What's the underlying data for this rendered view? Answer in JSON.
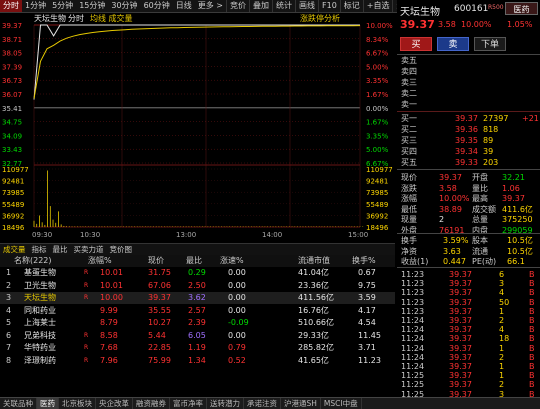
{
  "topbar": {
    "timeframes": [
      "分时",
      "1分钟",
      "5分钟",
      "15分钟",
      "30分钟",
      "60分钟",
      "日线",
      "更多 >"
    ],
    "tools": [
      "竞价",
      "叠加",
      "统计",
      "画线",
      "F10",
      "标记",
      "+自选",
      "返回"
    ]
  },
  "chart": {
    "header_name": "天坛生物",
    "header_mode": "分时",
    "header_legend": "均线 成交量",
    "limit_monitor": "涨跌停分析",
    "price_labels": [
      "39.37",
      "38.71",
      "38.05",
      "37.39",
      "36.73",
      "36.07",
      "35.41",
      "34.75",
      "34.09",
      "33.43",
      "32.77"
    ],
    "pct_labels": [
      "10.00%",
      "8.34%",
      "6.67%",
      "5.00%",
      "3.35%",
      "1.67%",
      "0.00%",
      "1.67%",
      "3.35%",
      "5.00%",
      "6.67%"
    ],
    "volume_labels": [
      "110977",
      "92481",
      "73985",
      "55489",
      "36992",
      "18496"
    ],
    "time_labels": [
      "09:30",
      "10:30",
      "13:00",
      "14:00",
      "15:00"
    ],
    "price_series": [
      35.8,
      39.37,
      39.37,
      38.85,
      39.37,
      39.37,
      39.37,
      39.37,
      39.37,
      39.37,
      39.37,
      39.37,
      39.37,
      39.37,
      39.37,
      39.37,
      39.37,
      39.37,
      39.37,
      39.37,
      39.37,
      39.37,
      39.37,
      39.37,
      39.37,
      39.37,
      39.37,
      39.37,
      39.37,
      39.37,
      39.37,
      39.37,
      39.37,
      39.37,
      39.37,
      39.37,
      39.37,
      39.37,
      39.37,
      39.37,
      39.37,
      39.37,
      39.37,
      39.37,
      39.37,
      39.37,
      39.37,
      39.37,
      39.37,
      39.37,
      39.37
    ],
    "volume_series": [
      12000,
      6000,
      22000,
      9000,
      4000,
      108000,
      40000,
      14000,
      8000,
      30000,
      5000,
      2000,
      1500,
      1200,
      1000,
      900,
      800,
      800,
      700,
      600,
      500,
      500,
      400,
      400,
      400,
      300,
      300,
      300,
      300,
      300,
      300,
      200,
      200,
      200,
      200,
      200,
      200,
      200,
      200,
      200,
      200,
      200,
      200,
      200,
      200,
      200,
      200,
      200,
      200,
      200,
      200,
      200,
      200,
      200,
      200,
      200,
      200,
      200,
      200,
      200,
      200,
      200,
      200,
      200,
      200,
      200,
      200,
      200,
      200,
      200,
      200,
      200,
      200,
      200,
      200,
      200,
      200,
      200,
      200,
      200,
      200,
      200,
      200,
      200,
      200,
      200,
      200,
      200,
      200,
      200,
      200,
      200,
      200,
      200,
      200,
      200,
      200,
      200,
      200,
      200,
      200,
      200,
      200,
      200,
      200,
      200,
      200,
      200,
      200,
      200,
      200,
      200,
      200,
      200,
      200,
      200,
      200,
      200,
      200,
      200,
      200,
      200
    ]
  },
  "stock": {
    "name": "天坛生物",
    "code": "600161",
    "tag": "R500",
    "sector_button": "医药",
    "sector_pct": "1.05%",
    "price": "39.37",
    "change": "3.58",
    "change_pct": "10.00%",
    "buy_label": "买",
    "sell_label": "卖",
    "order_label": "下单"
  },
  "depth": {
    "asks": [
      {
        "label": "卖五",
        "price": "",
        "vol": ""
      },
      {
        "label": "卖四",
        "price": "",
        "vol": ""
      },
      {
        "label": "卖三",
        "price": "",
        "vol": ""
      },
      {
        "label": "卖二",
        "price": "",
        "vol": ""
      },
      {
        "label": "卖一",
        "price": "",
        "vol": ""
      }
    ],
    "bids": [
      {
        "label": "买一",
        "price": "39.37",
        "vol": "27397",
        "extra": "+21"
      },
      {
        "label": "买二",
        "price": "39.36",
        "vol": "818",
        "extra": ""
      },
      {
        "label": "买三",
        "price": "39.35",
        "vol": "89",
        "extra": ""
      },
      {
        "label": "买四",
        "price": "39.34",
        "vol": "39",
        "extra": ""
      },
      {
        "label": "买五",
        "price": "39.33",
        "vol": "203",
        "extra": ""
      }
    ]
  },
  "quote": [
    {
      "l1": "现价",
      "v1": "39.37",
      "c1": "red",
      "l2": "开盘",
      "v2": "32.21",
      "c2": "grn"
    },
    {
      "l1": "涨跌",
      "v1": "3.58",
      "c1": "red",
      "l2": "量比",
      "v2": "1.06",
      "c2": "red"
    },
    {
      "l1": "涨幅",
      "v1": "10.00%",
      "c1": "red",
      "l2": "最高",
      "v2": "39.37",
      "c2": "red"
    },
    {
      "l1": "最低",
      "v1": "38.89",
      "c1": "red",
      "l2": "成交额",
      "v2": "411.6亿",
      "c2": "yel"
    },
    {
      "l1": "现量",
      "v1": "2",
      "c1": "wht",
      "l2": "总量",
      "v2": "375250",
      "c2": "yel"
    },
    {
      "l1": "外盘",
      "v1": "76191",
      "c1": "red",
      "l2": "内盘",
      "v2": "299059",
      "c2": "grn"
    }
  ],
  "quote2": [
    {
      "l1": "换手",
      "v1": "3.59%",
      "l2": "股本",
      "v2": "10.5亿"
    },
    {
      "l1": "净资",
      "v1": "3.63",
      "l2": "流通",
      "v2": "10.5亿"
    },
    {
      "l1": "收益(1)",
      "v1": "0.447",
      "l2": "PE(动)",
      "v2": "66.1"
    }
  ],
  "ticks": [
    {
      "time": "11:23",
      "price": "39.37",
      "vol": "6",
      "flag": "B"
    },
    {
      "time": "11:23",
      "price": "39.37",
      "vol": "3",
      "flag": "B"
    },
    {
      "time": "11:23",
      "price": "39.37",
      "vol": "4",
      "flag": "B"
    },
    {
      "time": "11:23",
      "price": "39.37",
      "vol": "50",
      "flag": "B"
    },
    {
      "time": "11:23",
      "price": "39.37",
      "vol": "1",
      "flag": "B"
    },
    {
      "time": "11:24",
      "price": "39.37",
      "vol": "2",
      "flag": "B"
    },
    {
      "time": "11:24",
      "price": "39.37",
      "vol": "4",
      "flag": "B"
    },
    {
      "time": "11:24",
      "price": "39.37",
      "vol": "18",
      "flag": "B"
    },
    {
      "time": "11:24",
      "price": "39.37",
      "vol": "1",
      "flag": "B"
    },
    {
      "time": "11:24",
      "price": "39.37",
      "vol": "2",
      "flag": "B"
    },
    {
      "time": "11:24",
      "price": "39.37",
      "vol": "1",
      "flag": "B"
    },
    {
      "time": "11:25",
      "price": "39.37",
      "vol": "1",
      "flag": "B"
    },
    {
      "time": "11:25",
      "price": "39.37",
      "vol": "2",
      "flag": "B"
    },
    {
      "time": "11:25",
      "price": "39.37",
      "vol": "3",
      "flag": "B"
    }
  ],
  "bottom_tabs": [
    "成交量",
    "指标",
    "最比",
    "买卖力道",
    "竞价图"
  ],
  "table": {
    "headers": [
      "名称(222)",
      "涨幅%",
      "现价",
      "最比",
      "涨速%",
      "流通市值",
      "换手%"
    ],
    "rows": [
      {
        "n": "1",
        "name": "基蛋生物",
        "r": "R",
        "pct": "10.01",
        "price": "31.75",
        "q": "0.29",
        "qc": "grn",
        "spd": "0.00",
        "cap": "41.04亿",
        "turn": "0.67"
      },
      {
        "n": "2",
        "name": "卫光生物",
        "r": "R",
        "pct": "10.01",
        "price": "67.06",
        "q": "2.50",
        "qc": "red",
        "spd": "0.00",
        "cap": "23.36亿",
        "turn": "9.75"
      },
      {
        "n": "3",
        "name": "天坛生物",
        "r": "R",
        "pct": "10.00",
        "price": "39.37",
        "q": "3.62",
        "qc": "pur",
        "spd": "0.00",
        "cap": "411.56亿",
        "turn": "3.59"
      },
      {
        "n": "4",
        "name": "同和药业",
        "r": "",
        "pct": "9.99",
        "price": "35.55",
        "q": "2.57",
        "qc": "red",
        "spd": "0.00",
        "cap": "16.76亿",
        "turn": "4.17"
      },
      {
        "n": "5",
        "name": "上海莱士",
        "r": "",
        "pct": "8.79",
        "price": "10.27",
        "q": "2.39",
        "qc": "red",
        "spd": "-0.09",
        "cap": "510.66亿",
        "turn": "4.54"
      },
      {
        "n": "6",
        "name": "兄弟科技",
        "r": "R",
        "pct": "8.58",
        "price": "5.44",
        "q": "6.05",
        "qc": "pur",
        "spd": "0.00",
        "cap": "29.33亿",
        "turn": "11.45"
      },
      {
        "n": "7",
        "name": "华特药业",
        "r": "R",
        "pct": "7.68",
        "price": "22.85",
        "q": "1.19",
        "qc": "red",
        "spd": "0.79",
        "cap": "285.82亿",
        "turn": "3.71"
      },
      {
        "n": "8",
        "name": "泽璟制药",
        "r": "R",
        "pct": "7.96",
        "price": "75.99",
        "q": "1.34",
        "qc": "red",
        "spd": "0.52",
        "cap": "41.65亿",
        "turn": "11.23"
      }
    ]
  },
  "statusbar": [
    "关联品种",
    "医药",
    "北京板块",
    "央企改革",
    "融资融券",
    "富币净率",
    "送转潜力",
    "承诺注资",
    "沪港通SH",
    "MSCI中盘"
  ]
}
